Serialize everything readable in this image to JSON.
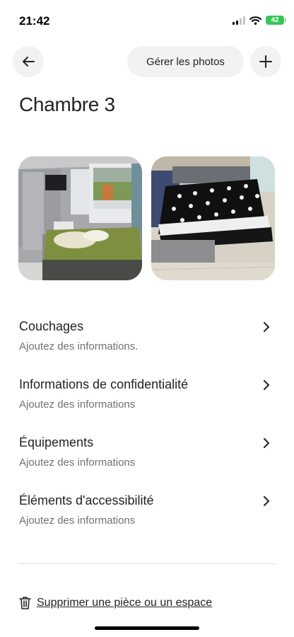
{
  "status_bar": {
    "time": "21:42",
    "battery": "42",
    "icons": [
      "cellular-signal-icon",
      "wifi-icon",
      "battery-icon"
    ]
  },
  "header": {
    "back_icon": "arrow-left-icon",
    "manage_photos_label": "Gérer les photos",
    "add_icon": "plus-icon"
  },
  "page": {
    "title": "Chambre 3"
  },
  "photos": [
    {
      "alt": "bedroom-photo"
    },
    {
      "alt": "sofa-bed-photo"
    }
  ],
  "sections": [
    {
      "title": "Couchages",
      "subtitle": "Ajoutez des informations."
    },
    {
      "title": "Informations de confidentialité",
      "subtitle": "Ajoutez des informations"
    },
    {
      "title": "Équipements",
      "subtitle": "Ajoutez des informations"
    },
    {
      "title": "Éléments d'accessibilité",
      "subtitle": "Ajoutez des informations"
    }
  ],
  "footer": {
    "delete_label": "Supprimer une pièce ou un espace",
    "delete_icon": "trash-icon"
  },
  "colors": {
    "text": "#222222",
    "secondary_text": "#717171",
    "button_bg": "#f2f2f2",
    "battery": "#34c759"
  }
}
